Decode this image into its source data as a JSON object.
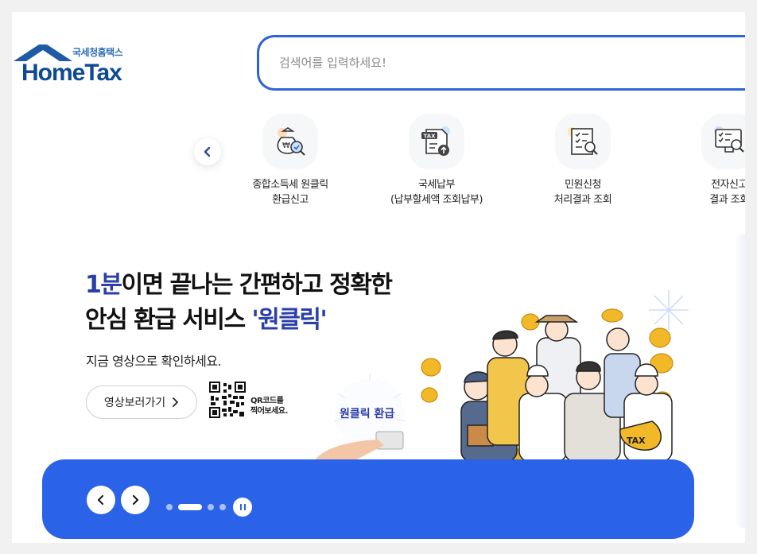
{
  "logo": {
    "sub": "국세청홈택스",
    "main": "HomeTax"
  },
  "search": {
    "placeholder": "검색어를 입력하세요!"
  },
  "quick_menu": {
    "items": [
      {
        "line1": "종합소득세 원클릭",
        "line2": "환급신고",
        "icon": "money-bag-search-icon"
      },
      {
        "line1": "국세납부",
        "line2": "(납부할세액 조회납부)",
        "icon": "tax-bill-icon"
      },
      {
        "line1": "민원신청",
        "line2": "처리결과 조회",
        "icon": "document-search-icon"
      },
      {
        "line1": "전자신고",
        "line2": "결과 조회",
        "icon": "monitor-search-icon"
      }
    ]
  },
  "banner": {
    "title_hl": "1분",
    "title_rest1": "이면 끝나는 간편하고 정확한",
    "title_line2a": "안심 환급 서비스 ",
    "title_line2b": "'원클릭'",
    "subtitle": "지금 영상으로 확인하세요.",
    "video_button": "영상보러가기",
    "qr_line1": "QR코드를",
    "qr_line2": "찍어보세요.",
    "badge_text": "원클릭 환급",
    "bag_text": "TAX"
  },
  "slider": {
    "total": 4,
    "current": 2
  },
  "colors": {
    "accent": "#2b63e8",
    "brand": "#0d4a93",
    "highlight": "#2b3fa8"
  }
}
